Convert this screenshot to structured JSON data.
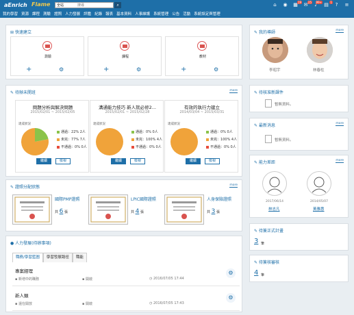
{
  "header": {
    "logo": "aEnrich",
    "logo2": "Flame",
    "search_scope": "全站",
    "search_placeholder": "搜尋",
    "search_icon": "search-icon",
    "menu": [
      "我的學習",
      "資源",
      "課程",
      "測驗",
      "證照",
      "人力發展",
      "評鑑",
      "紀錄",
      "報表",
      "基本資料",
      "人事維護",
      "系統管理",
      "公告",
      "活動",
      "系統設定與管理"
    ],
    "icons": [
      {
        "name": "home-icon",
        "glyph": "⌂"
      },
      {
        "name": "user-icon",
        "glyph": "◉"
      },
      {
        "name": "calendar-icon",
        "glyph": "▦",
        "badge": "19"
      },
      {
        "name": "mail-icon",
        "glyph": "✉",
        "badge": "25"
      },
      {
        "name": "bell-icon",
        "glyph": "♪",
        "badge": "99+"
      },
      {
        "name": "tasks-icon",
        "glyph": "▤",
        "badge": "1"
      },
      {
        "name": "help-icon",
        "glyph": "?"
      },
      {
        "name": "menu-icon",
        "glyph": "≡"
      }
    ]
  },
  "quick": {
    "title": "快速建立",
    "items": [
      {
        "label": "測驗"
      },
      {
        "label": "課程"
      },
      {
        "label": "教材"
      }
    ]
  },
  "courses": {
    "title": "待辦未開班",
    "more": "more",
    "status_label": "達成狀況",
    "legend_labels": [
      "通過",
      "未完",
      "不通過"
    ],
    "items": [
      {
        "title": "問題分析與解決問題",
        "date": "2015/02/01 ~ 2015/02/05",
        "values": [
          "22% 2人",
          "77% 7人",
          "0% 0人"
        ],
        "pass": 22,
        "unfinished": 78,
        "fail": 0
      },
      {
        "title": "溝通能力技巧 新人就必修2...",
        "date": "2015/02/01 ~ 2015/02/28",
        "values": [
          "0% 0人",
          "100% 4人",
          "0% 0人"
        ],
        "pass": 0,
        "unfinished": 100,
        "fail": 0
      },
      {
        "title": "有效的執行力建立",
        "date": "2014/03/04 ~ 2015/03/31",
        "values": [
          "0% 0人",
          "100% 4人",
          "0% 0人"
        ],
        "pass": 0,
        "unfinished": 100,
        "fail": 0
      }
    ],
    "btn_primary": "繼續",
    "btn_secondary": "檢視"
  },
  "certs": {
    "title": "證照分配狀態",
    "more": "more",
    "count_prefix": "共",
    "count_suffix": "張",
    "items": [
      {
        "name": "國際PMP證照",
        "count": "6"
      },
      {
        "name": "LPIC國際證照",
        "count": "4"
      },
      {
        "name": "人身保險證照",
        "count": "3"
      }
    ]
  },
  "hr": {
    "title": "人力發展(待辦事項)",
    "tabs": [
      "職務/學習藍圖",
      "學習發展路徑",
      "職能"
    ],
    "tasks": [
      {
        "name": "專案經理",
        "meta1": "新增中的職務",
        "meta2": "開啟",
        "time": "2016/07/05 17:44"
      },
      {
        "name": "新人類",
        "meta1": "還在開放",
        "meta2": "開啟",
        "time": "2016/07/05 17:43"
      }
    ]
  },
  "right": {
    "teachers": {
      "title": "我的導師",
      "more": "more",
      "names": [
        "李昭宇",
        "林春柱"
      ]
    },
    "pending": {
      "title": "待核准新課件",
      "empty": "暫無資料。"
    },
    "latest": {
      "title": "最新消息",
      "more": "more",
      "empty": "暫無資料。"
    },
    "gaps": {
      "title": "能力差距",
      "more": "more",
      "people": [
        {
          "date": "2017/06/14",
          "name": "林志凡"
        },
        {
          "date": "2014/05/07",
          "name": "黃雅惠"
        }
      ]
    },
    "plans": {
      "title": "待簽正式計畫",
      "count": "3",
      "unit": "筆"
    },
    "approvals": {
      "title": "待簽核審核",
      "count": "4",
      "unit": "筆"
    }
  },
  "colors": {
    "primary": "#1e6fa8",
    "pass": "#8bc34a",
    "unfinished": "#f0a33a",
    "fail": "#e74c3c"
  }
}
